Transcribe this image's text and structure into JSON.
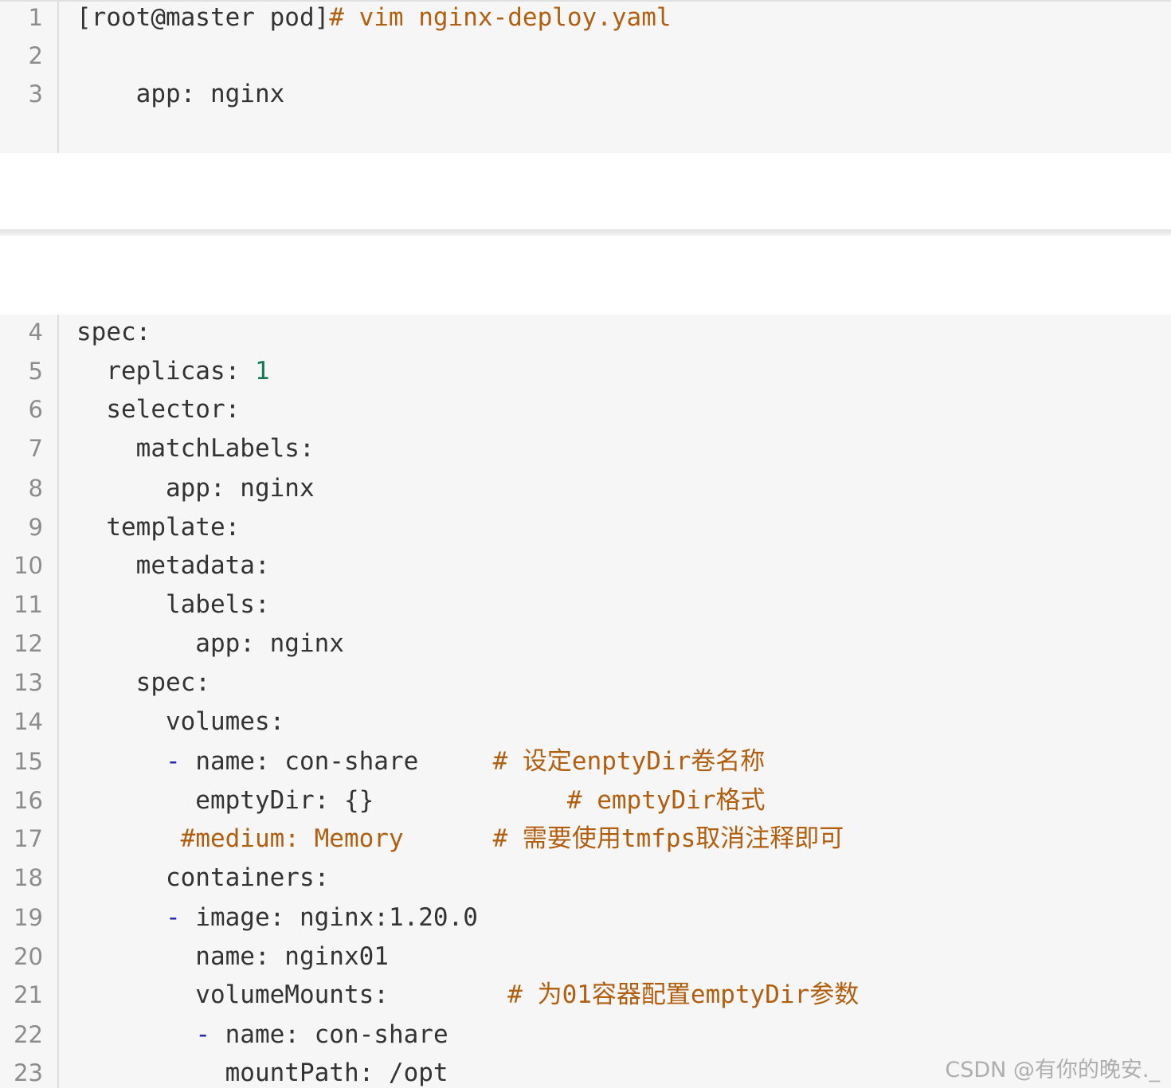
{
  "top_block": {
    "lines": [
      {
        "number": "1",
        "prompt": "[root@master pod]",
        "command": "# vim nginx-deploy.yaml"
      },
      {
        "number": "2",
        "text": ""
      },
      {
        "number": "3",
        "text": "    app: nginx"
      }
    ]
  },
  "main_block": {
    "lines": [
      {
        "number": "4",
        "text": "spec:"
      },
      {
        "number": "5",
        "key": "  replicas: ",
        "value": "1"
      },
      {
        "number": "6",
        "text": "  selector:"
      },
      {
        "number": "7",
        "text": "    matchLabels:"
      },
      {
        "number": "8",
        "text": "      app: nginx"
      },
      {
        "number": "9",
        "text": "  template:"
      },
      {
        "number": "10",
        "text": "    metadata:"
      },
      {
        "number": "11",
        "text": "      labels:"
      },
      {
        "number": "12",
        "text": "        app: nginx"
      },
      {
        "number": "13",
        "text": "    spec:"
      },
      {
        "number": "14",
        "text": "      volumes:"
      },
      {
        "number": "15",
        "indent": "      ",
        "dash": "-",
        "text": " name: con-share     ",
        "comment": "# 设定enptyDir卷名称"
      },
      {
        "number": "16",
        "text": "        emptyDir: {}           ",
        "comment": "  # emptyDir格式"
      },
      {
        "number": "17",
        "indent": "       ",
        "comment_code": "#medium: Memory",
        "pad": "      ",
        "comment": "# 需要使用tmfps取消注释即可"
      },
      {
        "number": "18",
        "text": "      containers:"
      },
      {
        "number": "19",
        "indent": "      ",
        "dash": "-",
        "text": " image: nginx:1.20.0"
      },
      {
        "number": "20",
        "text": "        name: nginx01"
      },
      {
        "number": "21",
        "text": "        volumeMounts:        ",
        "comment": "# 为01容器配置emptyDir参数"
      },
      {
        "number": "22",
        "indent": "        ",
        "dash": "-",
        "text": " name: con-share"
      },
      {
        "number": "23",
        "text": "          mountPath: /opt"
      }
    ]
  },
  "watermark": "CSDN @有你的晚安._",
  "colors": {
    "code_bg": "#f6f6f6",
    "text": "#333333",
    "comment": "#b15f0f",
    "number": "#117755",
    "dash": "#2626b8",
    "line_number": "#8c8c8c"
  }
}
